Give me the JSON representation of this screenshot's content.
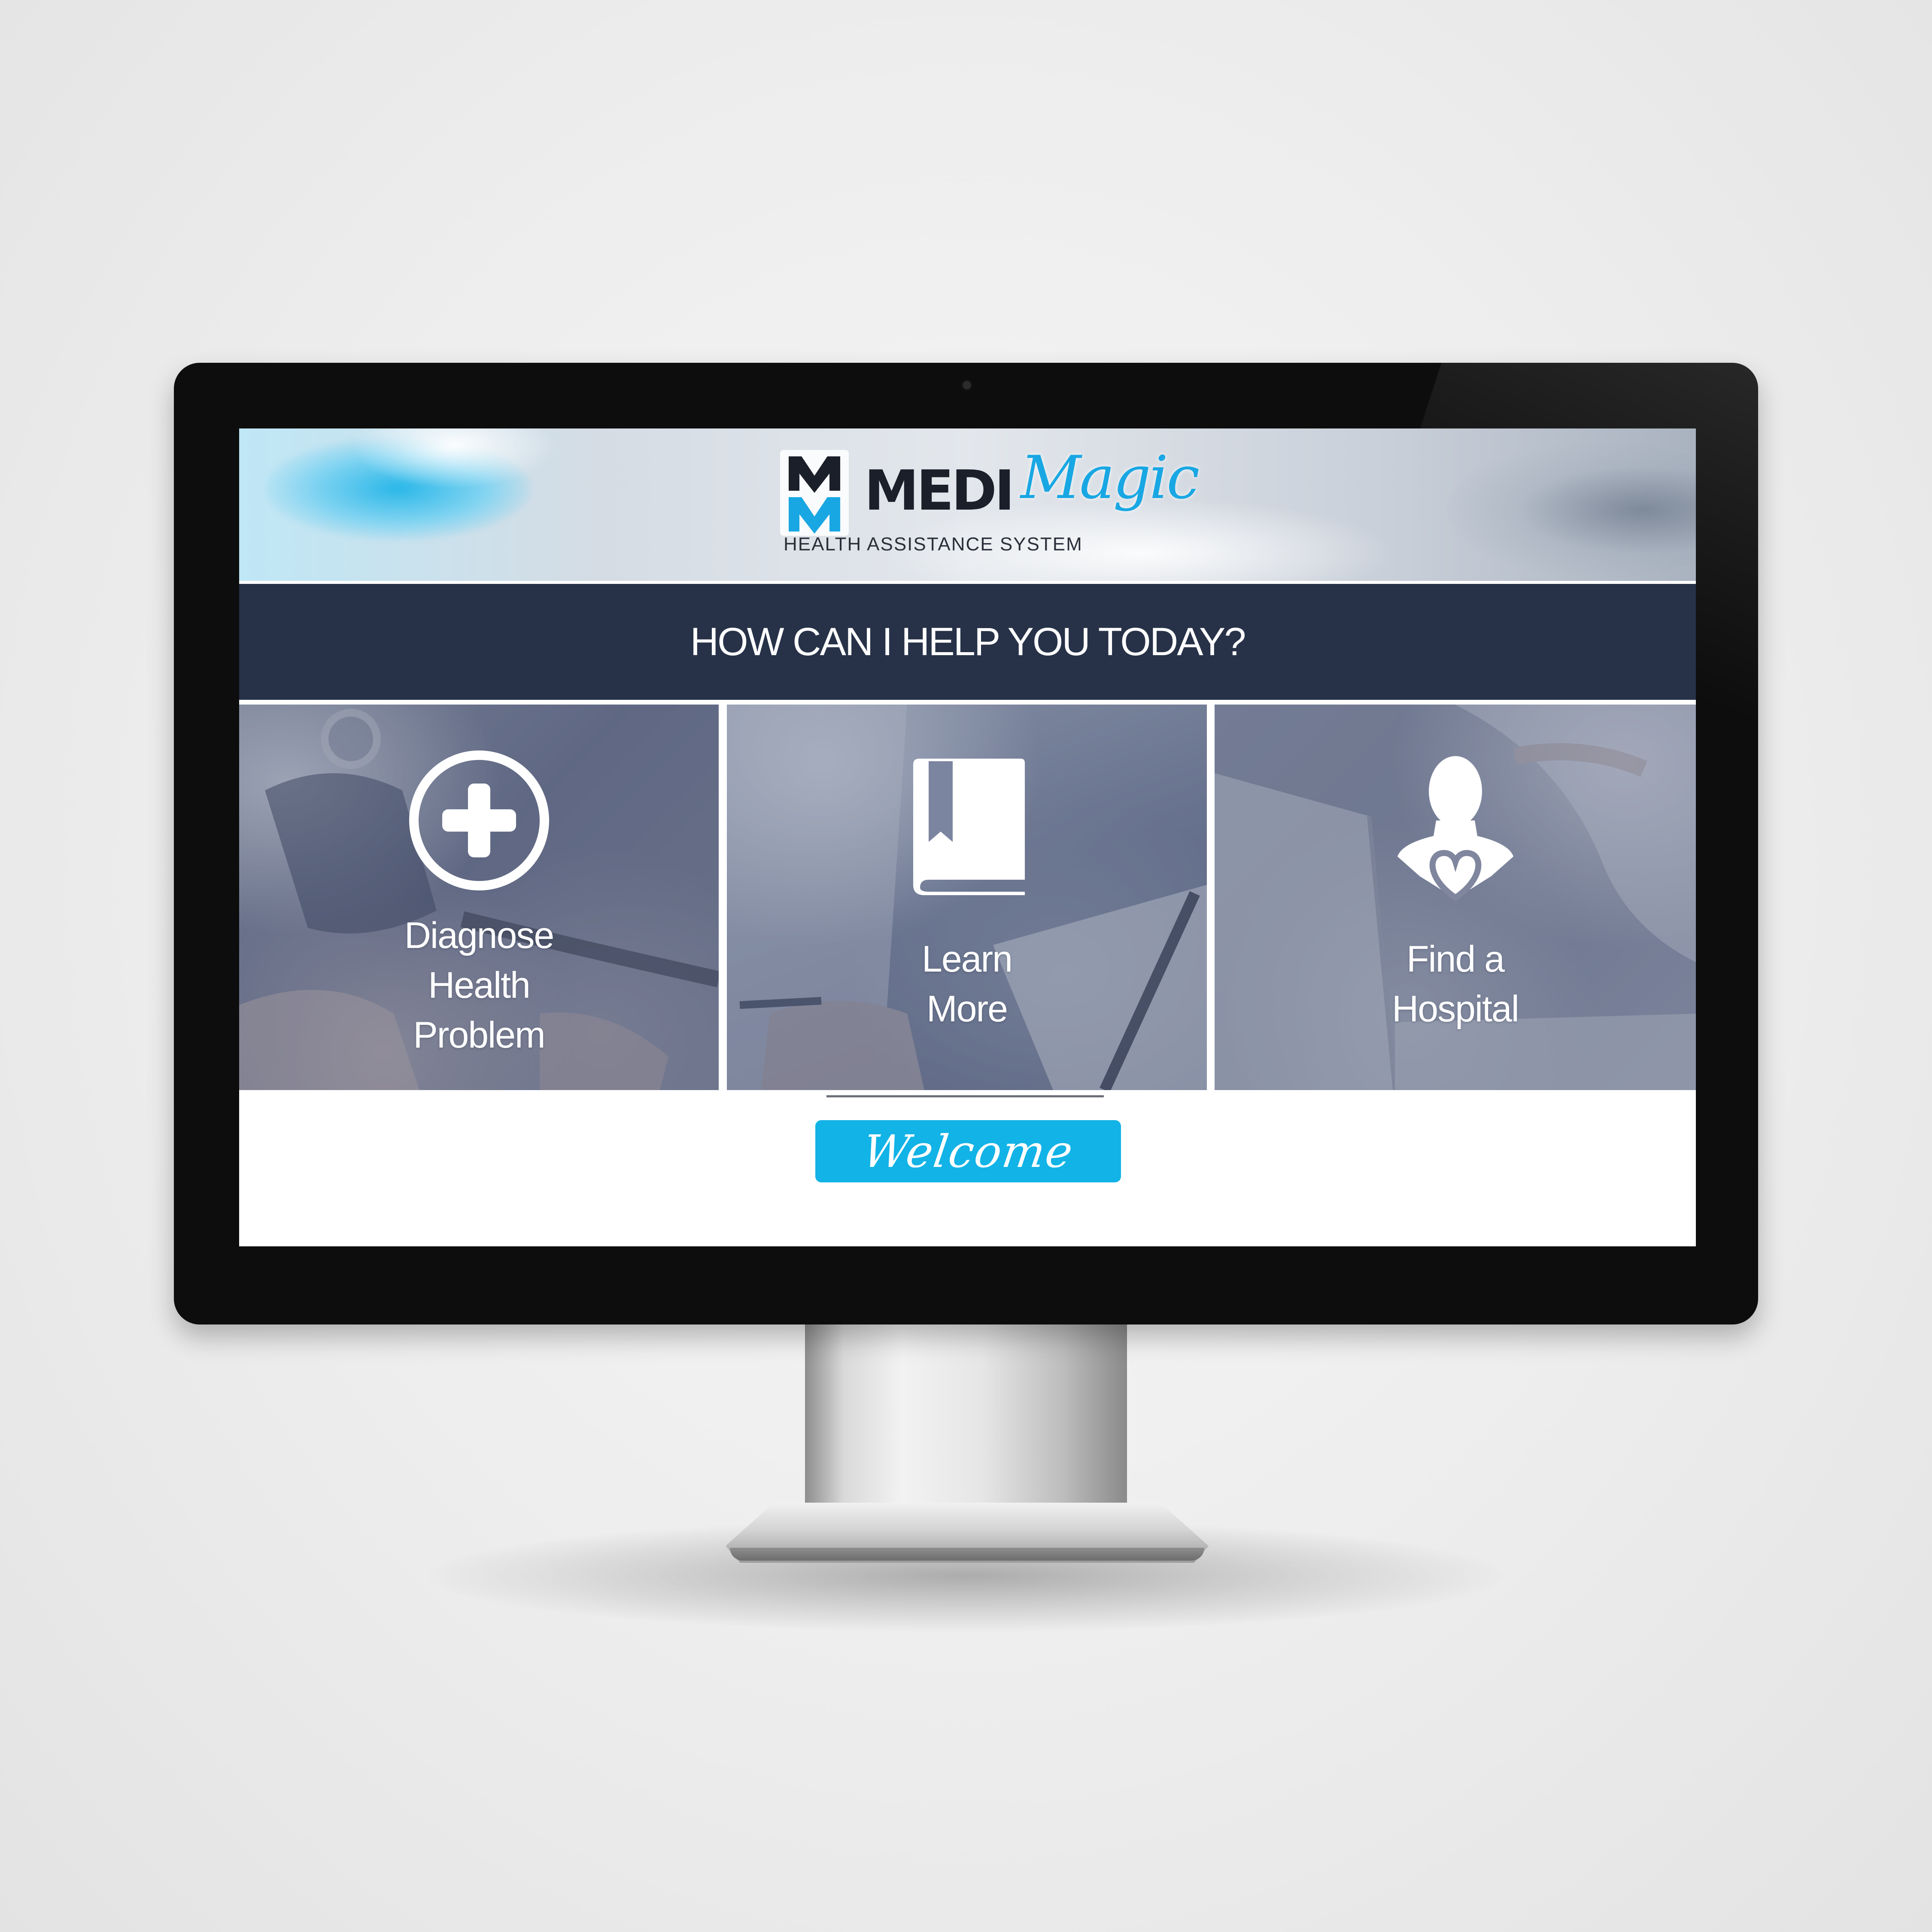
{
  "app": {
    "brand": {
      "medi": "MEDI",
      "magic": "Magic",
      "tagline": "HEALTH ASSISTANCE SYSTEM"
    },
    "prompt": "HOW CAN I HELP YOU TODAY?",
    "tiles": [
      {
        "label": "Diagnose\nHealth\nProblem",
        "icon": "medical-plus-icon"
      },
      {
        "label": "Learn\nMore",
        "icon": "book-icon"
      },
      {
        "label": "Find a\nHospital",
        "icon": "person-heart-icon"
      }
    ],
    "welcome_button": "Welcome"
  },
  "colors": {
    "accent": "#12b3e6",
    "prompt_bar": "#273248",
    "bezel": "#0d0d0d",
    "logo_dark": "#1b1f2a",
    "logo_blue": "#19a7e3"
  }
}
